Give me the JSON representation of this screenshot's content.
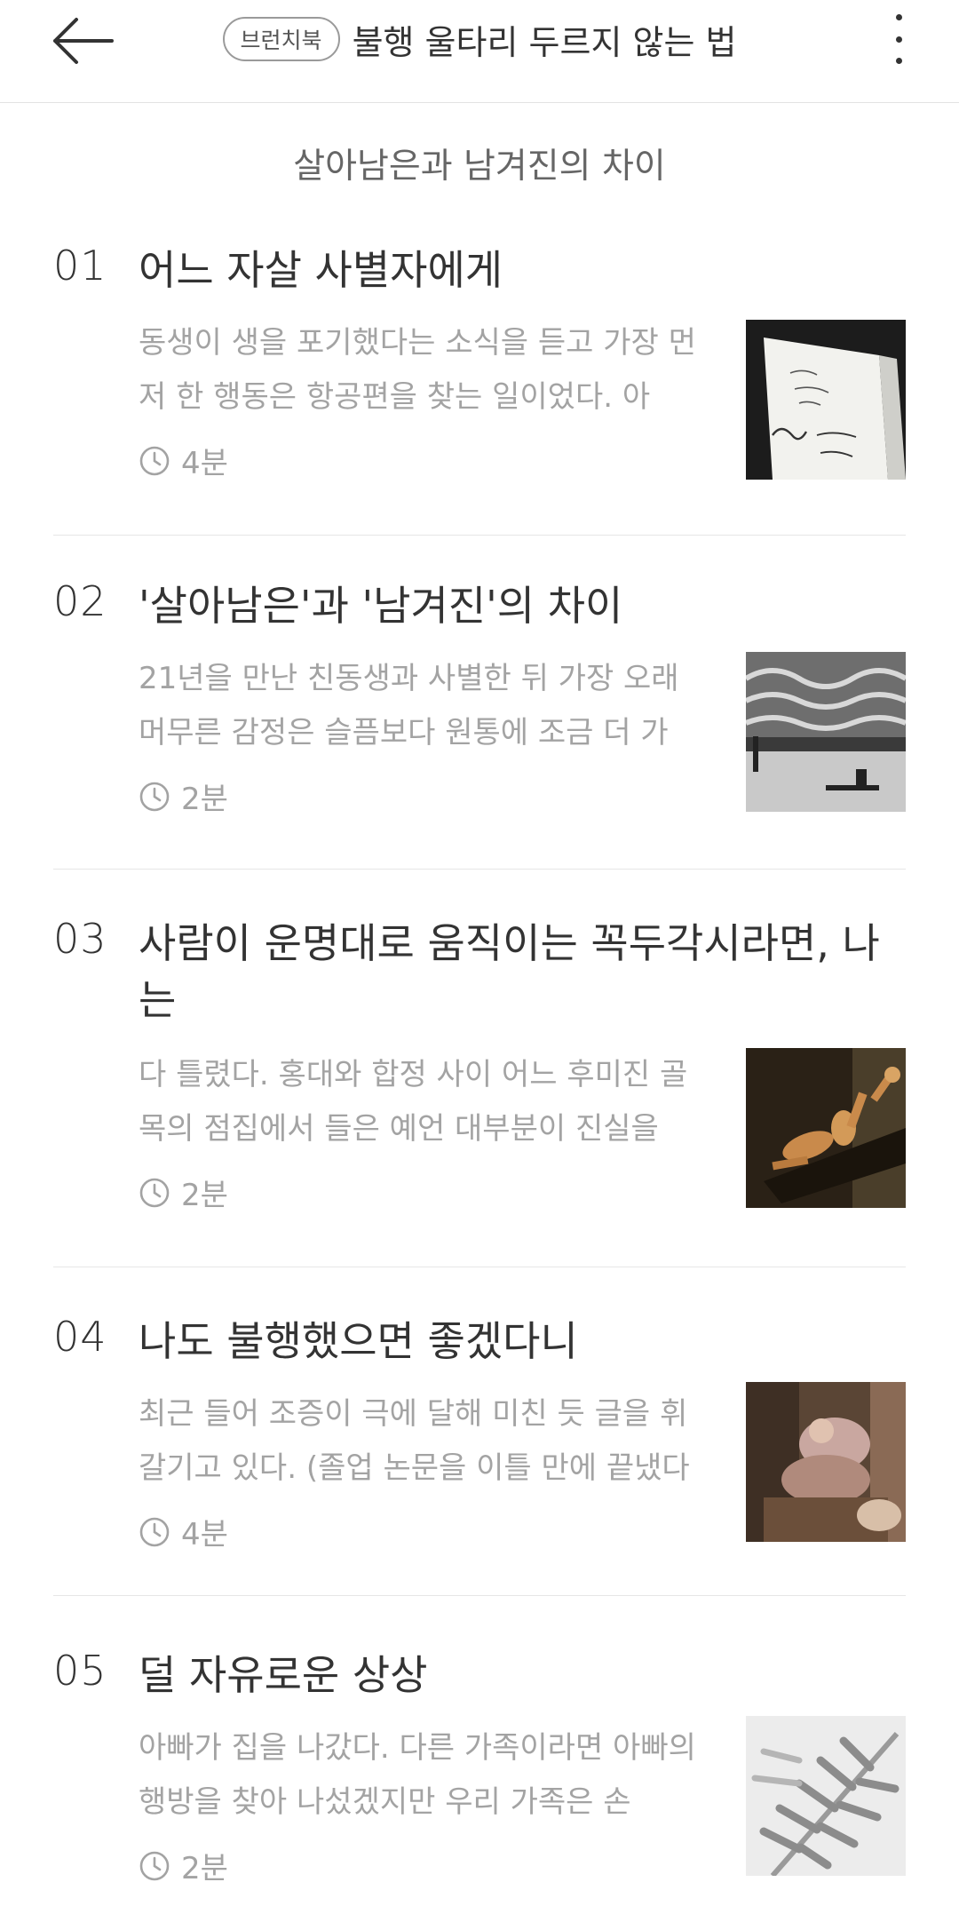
{
  "header": {
    "badge": "브런치북",
    "title": "불행 울타리 두르지 않는 법"
  },
  "subtitle": "살아남은과 남겨진의 차이",
  "items": [
    {
      "num": "01",
      "title": "어느 자살 사별자에게",
      "excerpt": "동생이 생을 포기했다는 소식을 듣고 가장 먼저 한 행동은 항공편을 찾는 일이었다. 아",
      "time": "4분",
      "thumb": "book-image"
    },
    {
      "num": "02",
      "title": "'살아남은'과 '남겨진'의 차이",
      "excerpt": "21년을 만난 친동생과 사별한 뒤 가장 오래 머무른 감정은 슬픔보다 원통에 조금 더 가",
      "time": "2분",
      "thumb": "seaside-image"
    },
    {
      "num": "03",
      "title": "사람이 운명대로 움직이는 꼭두각시라면, 나는",
      "excerpt": "다 틀렸다. 홍대와 합정 사이 어느 후미진 골목의 점집에서 들은 예언 대부분이 진실을",
      "time": "2분",
      "thumb": "mannequin-image"
    },
    {
      "num": "04",
      "title": "나도 불행했으면 좋겠다니",
      "excerpt": "최근 들어 조증이 극에 달해 미친 듯 글을 휘갈기고 있다. (졸업 논문을 이틀 만에 끝냈다",
      "time": "4분",
      "thumb": "painting-image"
    },
    {
      "num": "05",
      "title": "덜 자유로운 상상",
      "excerpt": "아빠가 집을 나갔다. 다른 가족이라면 아빠의 행방을 찾아 나섰겠지만 우리 가족은 손",
      "time": "2분",
      "thumb": "leaf-shadow-image"
    }
  ],
  "colors": {
    "text": "#333333",
    "muted": "#a3a3a3",
    "divider": "#e6e6e6"
  }
}
